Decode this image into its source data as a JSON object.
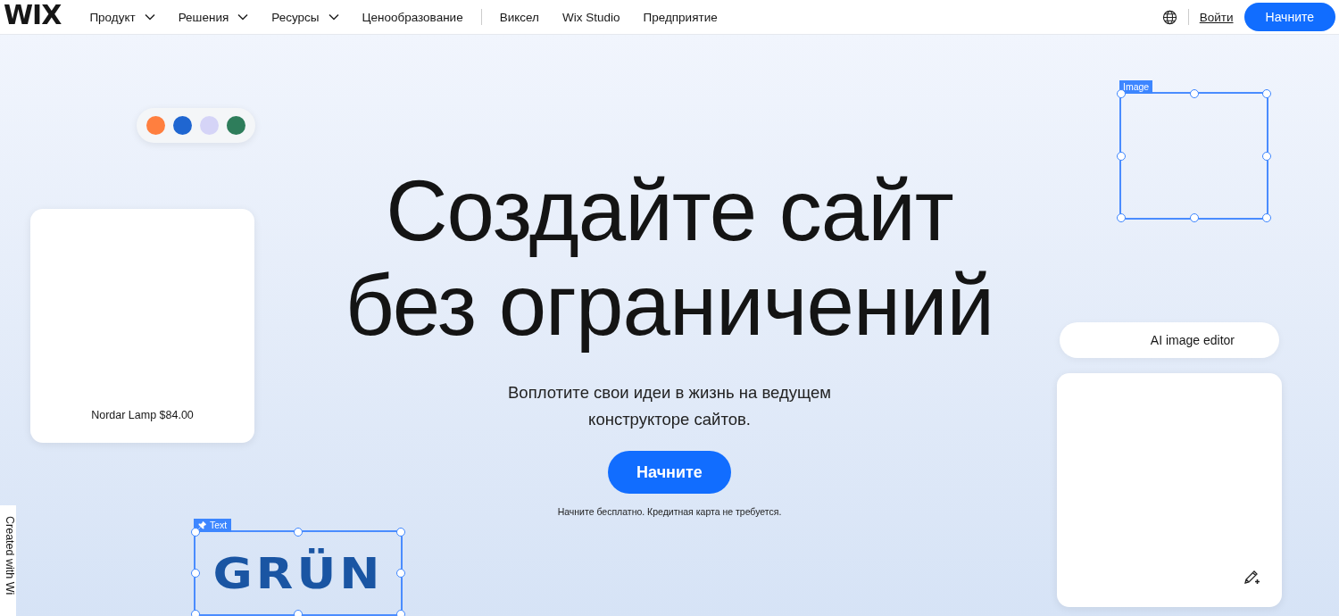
{
  "header": {
    "logo": "WIX",
    "nav_primary": [
      {
        "label": "Продукт",
        "kind": "menu"
      },
      {
        "label": "Решения",
        "kind": "menu"
      },
      {
        "label": "Ресурсы",
        "kind": "menu"
      },
      {
        "label": "Ценообразование",
        "kind": "link"
      }
    ],
    "nav_secondary": [
      {
        "label": "Виксел"
      },
      {
        "label": "Wix Studio"
      },
      {
        "label": "Предприятие"
      }
    ],
    "login": "Войти",
    "cta": "Начните"
  },
  "hero": {
    "title_lines": [
      "Создайте сайт",
      "без ограничений"
    ],
    "subtitle": "Воплотите свои идеи в жизнь на ведущем конструкторе сайтов.",
    "cta": "Начните",
    "note": "Начните бесплатно. Кредитная карта не требуется."
  },
  "swatches": [
    {
      "color": "#ff7f3f"
    },
    {
      "color": "#1f66d1"
    },
    {
      "color": "#d5d4f7"
    },
    {
      "color": "#2e7d5b"
    }
  ],
  "product_card": {
    "caption": "Nordar Lamp $84.00"
  },
  "image_frame": {
    "tag": "Image"
  },
  "text_frame": {
    "tag": "Text",
    "content": "GRÜN"
  },
  "ai_editor": {
    "label": "AI image editor"
  },
  "badge": "Created with Wi"
}
